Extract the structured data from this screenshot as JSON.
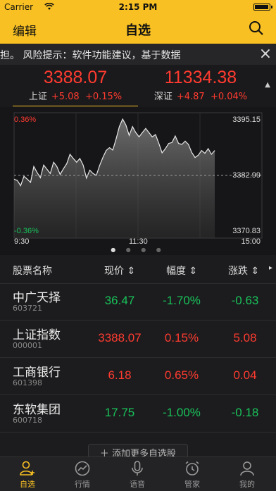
{
  "status_bar": {
    "carrier": "Carrier",
    "time": "2:15 PM",
    "battery_level": 1.0
  },
  "nav": {
    "edit_label": "编辑",
    "title": "自选",
    "search_icon": "search-icon"
  },
  "ticker": {
    "text": "担。    风险提示：软件功能建议，基于数据",
    "close_label": "×"
  },
  "indices": [
    {
      "value": "3388.07",
      "name": "上证",
      "change": "+5.08",
      "percent": "+0.15%"
    },
    {
      "value": "11334.38",
      "name": "深证",
      "change": "+4.87",
      "percent": "+0.04%"
    }
  ],
  "chart_labels": {
    "top_pct": "0.36%",
    "bottom_pct": "-0.36%",
    "top_price": "3395.15",
    "mid_price": "3382.99",
    "bottom_price": "3370.83",
    "t_start": "9:30",
    "t_mid": "11:30",
    "t_end": "15:00"
  },
  "chart_data": {
    "type": "area",
    "x_range": [
      "9:30",
      "15:00"
    ],
    "ylim": [
      3370.83,
      3395.15
    ],
    "baseline": 3382.99,
    "values": [
      3382.2,
      3381.9,
      3380.8,
      3382.8,
      3382.2,
      3381.5,
      3384.9,
      3383.6,
      3382.5,
      3385.2,
      3384.3,
      3383.4,
      3385.8,
      3384.9,
      3383.2,
      3384.4,
      3385.5,
      3387.5,
      3386.6,
      3385.8,
      3386.6,
      3385.2,
      3382.4,
      3384.1,
      3383.4,
      3383.0,
      3385.1,
      3386.8,
      3388.3,
      3388.9,
      3388.4,
      3390.7,
      3393.4,
      3395.0,
      3393.7,
      3391.5,
      3393.4,
      3392.1,
      3391.2,
      3392.1,
      3393.0,
      3392.1,
      3391.2,
      3391.7,
      3389.8,
      3387.8,
      3388.7,
      3389.8,
      3390.0,
      3391.4,
      3389.8,
      3389.6,
      3390.3,
      3389.6,
      3387.9,
      3386.8,
      3387.3,
      3388.3,
      3387.7,
      3388.7,
      3387.5,
      3388.3
    ]
  },
  "page_dots": "● ● ● ●",
  "table": {
    "col_name": "股票名称",
    "col_price": "现价 ⇕",
    "col_pct": "幅度 ⇕",
    "col_chg": "涨跌 ⇕",
    "rows": [
      {
        "name": "中广天择",
        "code": "603721",
        "price": "36.47",
        "pct": "-1.70%",
        "chg": "-0.63",
        "color": "#19c25a"
      },
      {
        "name": "上证指数",
        "code": "000001",
        "price": "3388.07",
        "pct": "0.15%",
        "chg": "5.08",
        "color": "#ff3b30"
      },
      {
        "name": "工商银行",
        "code": "601398",
        "price": "6.18",
        "pct": "0.65%",
        "chg": "0.04",
        "color": "#ff3b30"
      },
      {
        "name": "东软集团",
        "code": "600718",
        "price": "17.75",
        "pct": "-1.00%",
        "chg": "-0.18",
        "color": "#19c25a"
      }
    ]
  },
  "add_button": "＋ 添加更多自选股",
  "tabs": [
    {
      "label": "自选",
      "icon": "user-add-icon"
    },
    {
      "label": "行情",
      "icon": "chart-circle-icon"
    },
    {
      "label": "语音",
      "icon": "microphone-icon"
    },
    {
      "label": "管家",
      "icon": "alarm-clock-icon"
    },
    {
      "label": "我的",
      "icon": "person-icon"
    }
  ],
  "colors": {
    "accent": "#f8c022",
    "up": "#ff3b30",
    "down": "#19c25a"
  }
}
